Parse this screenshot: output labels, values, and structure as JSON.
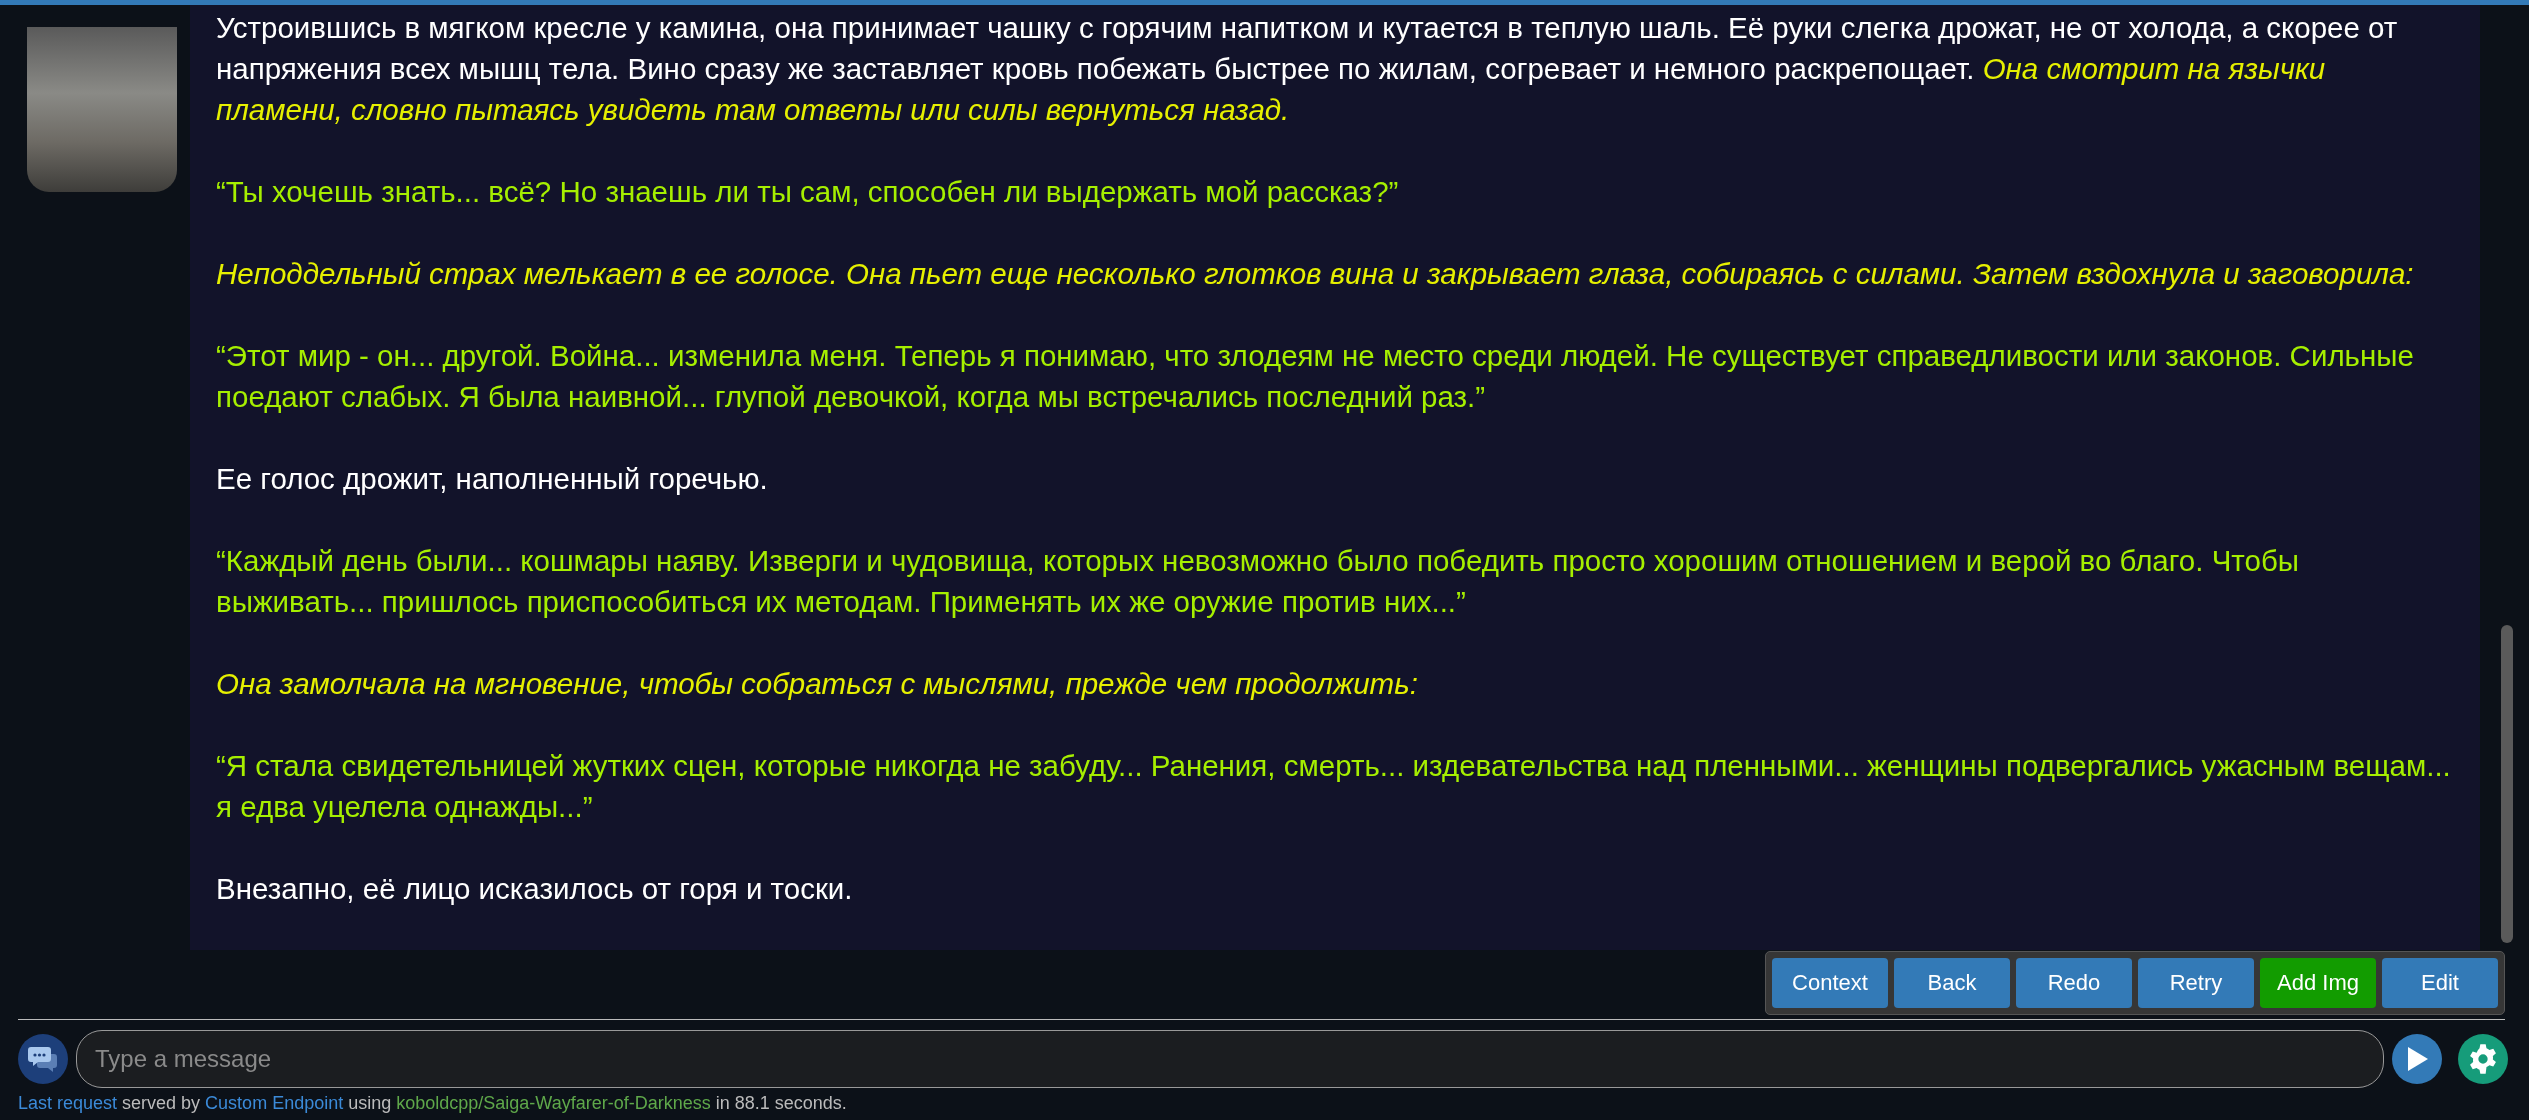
{
  "messages": [
    {
      "paragraphs": [
        [
          {
            "kind": "narration",
            "text": "Устроившись в мягком кресле у камина, она принимает чашку с горячим напитком и кутается в теплую шаль. Её руки слегка дрожат, не от холода, а скорее от напряжения всех мышц тела. Вино сразу же заставляет кровь побежать быстрее по жилам, согревает и немного раскрепощает. "
          },
          {
            "kind": "action",
            "text": "Она смотрит на язычки пламени, словно пытаясь увидеть там ответы или силы вернуться назад."
          }
        ],
        [
          {
            "kind": "speech",
            "text": "“Ты хочешь знать... всё? Но знаешь ли ты сам, способен ли выдержать мой рассказ?”"
          }
        ],
        [
          {
            "kind": "action",
            "text": "Неподдельный страх мелькает в ее голосе. Она пьет еще несколько глотков вина и закрывает глаза, собираясь с силами. Затем вздохнула и заговорила:"
          }
        ],
        [
          {
            "kind": "speech",
            "text": "“Этот мир - он... другой. Война... изменила меня. Теперь я понимаю, что злодеям не место среди людей. Не существует справедливости или законов. Сильные поедают слабых. Я была наивной... глупой девочкой, когда мы встречались последний раз.”"
          }
        ],
        [
          {
            "kind": "narration",
            "text": "Ее голос дрожит, наполненный горечью."
          }
        ],
        [
          {
            "kind": "speech",
            "text": "“Каждый день были... кошмары наяву. Изверги и чудовища, которых невозможно было победить просто хорошим отношением и верой во благо. Чтобы выживать... пришлось приспособиться их методам. Применять их же оружие против них...”"
          }
        ],
        [
          {
            "kind": "action",
            "text": "Она замолчала на мгновение, чтобы собраться с мыслями, прежде чем продолжить:"
          }
        ],
        [
          {
            "kind": "speech",
            "text": "“Я стала свидетельницей жутких сцен, которые никогда не забуду... Ранения, смерть... издевательства над пленными... женщины подвергались ужасным вещам... я едва уцелела однажды...”"
          }
        ],
        [
          {
            "kind": "narration",
            "text": "Внезапно, её лицо исказилось от горя и тоски."
          }
        ]
      ]
    }
  ],
  "actions": [
    {
      "label": "Context",
      "color": "#337ab7"
    },
    {
      "label": "Back",
      "color": "#337ab7"
    },
    {
      "label": "Redo",
      "color": "#337ab7"
    },
    {
      "label": "Retry",
      "color": "#337ab7"
    },
    {
      "label": "Add Img",
      "color": "#129c00"
    },
    {
      "label": "Edit",
      "color": "#337ab7"
    }
  ],
  "input": {
    "placeholder": "Type a message"
  },
  "status_line": [
    {
      "kind": "link",
      "text": "Last request"
    },
    {
      "kind": "plain",
      "text": " served by "
    },
    {
      "kind": "link",
      "text": "Custom Endpoint"
    },
    {
      "kind": "plain",
      "text": " using "
    },
    {
      "kind": "model",
      "text": "koboldcpp/Saiga-Wayfarer-of-Darkness"
    },
    {
      "kind": "plain",
      "text": " in 88.1 seconds."
    }
  ]
}
